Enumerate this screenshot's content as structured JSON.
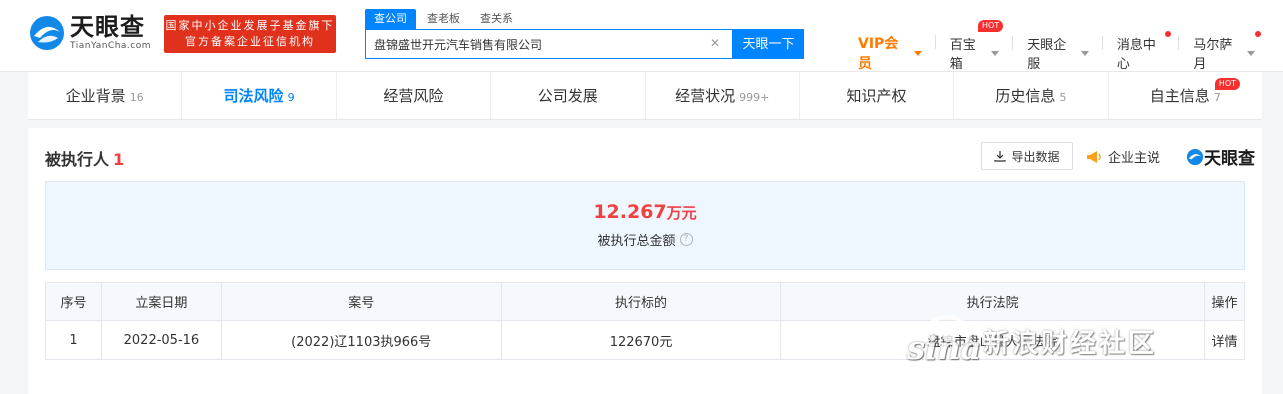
{
  "logo": {
    "name_cn": "天眼查",
    "name_en": "TianYanCha.com"
  },
  "promo_badge": {
    "line1": "国家中小企业发展子基金旗下",
    "line2": "官方备案企业征信机构"
  },
  "search": {
    "tabs": [
      "查公司",
      "查老板",
      "查关系"
    ],
    "value": "盘锦盛世开元汽车销售有限公司",
    "button": "天眼一下"
  },
  "topnav": {
    "vip": "VIP会员",
    "treasure": "百宝箱",
    "treasure_hot": "HOT",
    "enterprise": "天眼企服",
    "messages": "消息中心",
    "user": "马尔萨月"
  },
  "tabs": [
    {
      "label": "企业背景",
      "count": "16"
    },
    {
      "label": "司法风险",
      "count": "9"
    },
    {
      "label": "经营风险",
      "count": ""
    },
    {
      "label": "公司发展",
      "count": ""
    },
    {
      "label": "经营状况",
      "count": "999+"
    },
    {
      "label": "知识产权",
      "count": ""
    },
    {
      "label": "历史信息",
      "count": "5"
    },
    {
      "label": "自主信息",
      "count": "7",
      "hot": "HOT"
    }
  ],
  "section": {
    "title": "被执行人",
    "count": "1",
    "export": "导出数据",
    "enterprise_say": "企业主说",
    "brand": "天眼查"
  },
  "summary": {
    "amount": "12.267",
    "unit": "万元",
    "label": "被执行总金额",
    "help": "?"
  },
  "table": {
    "headers": [
      "序号",
      "立案日期",
      "案号",
      "执行标的",
      "执行法院",
      "操作"
    ],
    "rows": [
      [
        "1",
        "2022-05-16",
        "(2022)辽1103执966号",
        "122670元",
        "盘锦市盘山县人民法院",
        "详情"
      ]
    ]
  },
  "watermark": {
    "logo": "sina",
    "text": "新浪财经社区"
  },
  "colors": {
    "accent": "#0084ff",
    "danger": "#f04141",
    "vip": "#ff7b00"
  }
}
